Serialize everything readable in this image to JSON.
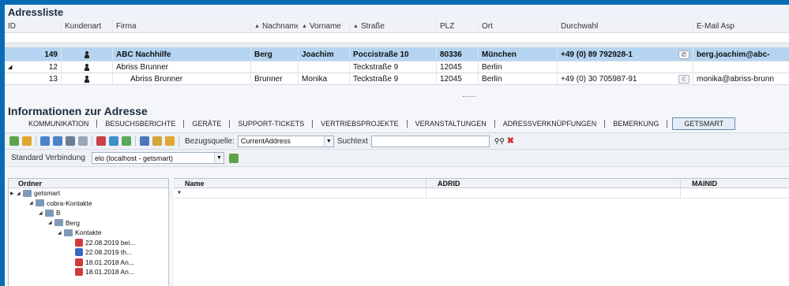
{
  "adressliste": {
    "title": "Adressliste",
    "columns": {
      "id": "ID",
      "kundenart": "Kundenart",
      "firma": "Firma",
      "nachname": "Nachname",
      "vorname": "Vorname",
      "strasse": "Straße",
      "plz": "PLZ",
      "ort": "Ort",
      "durchwahl": "Durchwahl",
      "email": "E-Mail Asp"
    },
    "rows": [
      {
        "id": "149",
        "firma": "ABC Nachhilfe",
        "nachname": "Berg",
        "vorname": "Joachim",
        "strasse": "Poccistraße 10",
        "plz": "80336",
        "ort": "München",
        "durchwahl": "+49 (0) 89 792928-1",
        "email": "berg.joachim@abc-"
      },
      {
        "id": "12",
        "firma": "Abriss Brunner",
        "nachname": "",
        "vorname": "",
        "strasse": "Teckstraße 9",
        "plz": "12045",
        "ort": "Berlin",
        "durchwahl": "",
        "email": ""
      },
      {
        "id": "13",
        "firma": "Abriss Brunner",
        "nachname": "Brunner",
        "vorname": "Monika",
        "strasse": "Teckstraße 9",
        "plz": "12045",
        "ort": "Berlin",
        "durchwahl": "+49 (0) 30 705987-91",
        "email": "monika@abriss-brunn"
      }
    ]
  },
  "info": {
    "title": "Informationen zur Adresse",
    "tabs": [
      "KOMMUNIKATION",
      "BESUCHSBERICHTE",
      "GERÄTE",
      "SUPPORT-TICKETS",
      "VERTRIEBSPROJEKTE",
      "VERANSTALTUNGEN",
      "ADRESSVERKNÜPFUNGEN",
      "BEMERKUNG",
      "GETSMART"
    ],
    "toolbar": {
      "bezugsquelle_label": "Bezugsquelle:",
      "bezugsquelle_value": "CurrentAddress",
      "suchtext_label": "Suchtext"
    },
    "connection": {
      "label": "Standard Verbindung",
      "value": "elo (localhost - getsmart)"
    }
  },
  "tree": {
    "header": "Ordner",
    "nodes": [
      {
        "label": "getsmart",
        "kind": "folder"
      },
      {
        "label": "cobra-Kontakte",
        "kind": "folder"
      },
      {
        "label": "B",
        "kind": "folder"
      },
      {
        "label": "Berg",
        "kind": "folder"
      },
      {
        "label": "Kontakte",
        "kind": "folder"
      },
      {
        "label": "22.08.2019 bei...",
        "kind": "doc-red"
      },
      {
        "label": "22.08.2019 th...",
        "kind": "doc-blue"
      },
      {
        "label": "18.01.2018 An...",
        "kind": "doc-red"
      },
      {
        "label": "18.01.2018 An...",
        "kind": "doc-red"
      }
    ]
  },
  "docgrid": {
    "columns": {
      "name": "Name",
      "adrid": "ADRID",
      "mainid": "MAINID"
    }
  }
}
